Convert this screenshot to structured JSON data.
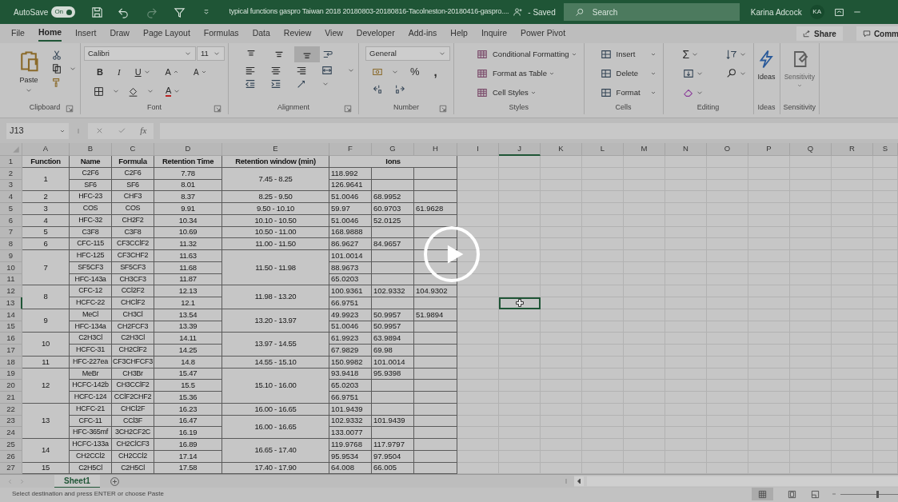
{
  "title_bar": {
    "autosave_label": "AutoSave",
    "autosave_toggle": {
      "label": "On",
      "on": true
    },
    "redo_disabled": true,
    "document_title": "typical functions gaspro Taiwan 2018 20180803-20180816-Tacolneston-20180416-gaspro....",
    "saved_status": "- Saved",
    "search_placeholder": "Search",
    "user_name": "Karina Adcock",
    "user_initials": "KA"
  },
  "menu_tabs": [
    {
      "label": "File",
      "selected": false
    },
    {
      "label": "Home",
      "selected": true
    },
    {
      "label": "Insert",
      "selected": false
    },
    {
      "label": "Draw",
      "selected": false
    },
    {
      "label": "Page Layout",
      "selected": false
    },
    {
      "label": "Formulas",
      "selected": false
    },
    {
      "label": "Data",
      "selected": false
    },
    {
      "label": "Review",
      "selected": false
    },
    {
      "label": "View",
      "selected": false
    },
    {
      "label": "Developer",
      "selected": false
    },
    {
      "label": "Add-ins",
      "selected": false
    },
    {
      "label": "Help",
      "selected": false
    },
    {
      "label": "Inquire",
      "selected": false
    },
    {
      "label": "Power Pivot",
      "selected": false
    }
  ],
  "share_button": "Share",
  "comments_button": "Comm",
  "ribbon": {
    "clipboard": {
      "paste": "Paste",
      "label": "Clipboard"
    },
    "font": {
      "font_name": "Calibri",
      "font_size": "11",
      "bold": "B",
      "italic": "I",
      "underline": "U",
      "grow": "A",
      "shrink": "A",
      "font_color": "A",
      "label": "Font"
    },
    "alignment": {
      "vertical": [
        {
          "kind": "top",
          "selected": false
        },
        {
          "kind": "middle",
          "selected": false
        },
        {
          "kind": "bottom",
          "selected": true
        }
      ],
      "label": "Alignment"
    },
    "number": {
      "format": "General",
      "percent": "%",
      "comma": ",",
      "label": "Number"
    },
    "styles": {
      "items": [
        "Conditional Formatting",
        "Format as Table",
        "Cell Styles"
      ],
      "label": "Styles"
    },
    "cells": {
      "items": [
        "Insert",
        "Delete",
        "Format"
      ],
      "label": "Cells"
    },
    "editing": {
      "sum": "Σ",
      "label": "Editing"
    },
    "ideas": {
      "button": "Ideas",
      "label": "Ideas"
    },
    "sensitivity": {
      "button": "Sensitivity",
      "disabled": true,
      "label": "Sensitivity"
    }
  },
  "formula_bar": {
    "name_box": "J13",
    "fx": "fx"
  },
  "sheet": {
    "columns": [
      {
        "label": "A",
        "selected": false
      },
      {
        "label": "B",
        "selected": false
      },
      {
        "label": "C",
        "selected": false
      },
      {
        "label": "D",
        "selected": false
      },
      {
        "label": "E",
        "selected": false
      },
      {
        "label": "F",
        "selected": false
      },
      {
        "label": "G",
        "selected": false
      },
      {
        "label": "H",
        "selected": false
      },
      {
        "label": "I",
        "selected": false
      },
      {
        "label": "J",
        "selected": true
      },
      {
        "label": "K",
        "selected": false
      },
      {
        "label": "L",
        "selected": false
      },
      {
        "label": "M",
        "selected": false
      },
      {
        "label": "N",
        "selected": false
      },
      {
        "label": "O",
        "selected": false
      },
      {
        "label": "P",
        "selected": false
      },
      {
        "label": "Q",
        "selected": false
      },
      {
        "label": "R",
        "selected": false
      },
      {
        "label": "S",
        "selected": false
      }
    ],
    "row_headers": [
      {
        "label": "1",
        "selected": false
      },
      {
        "label": "2",
        "selected": false
      },
      {
        "label": "3",
        "selected": false
      },
      {
        "label": "4",
        "selected": false
      },
      {
        "label": "5",
        "selected": false
      },
      {
        "label": "6",
        "selected": false
      },
      {
        "label": "7",
        "selected": false
      },
      {
        "label": "8",
        "selected": false
      },
      {
        "label": "9",
        "selected": false
      },
      {
        "label": "10",
        "selected": false
      },
      {
        "label": "11",
        "selected": false
      },
      {
        "label": "12",
        "selected": false
      },
      {
        "label": "13",
        "selected": true
      },
      {
        "label": "14",
        "selected": false
      },
      {
        "label": "15",
        "selected": false
      },
      {
        "label": "16",
        "selected": false
      },
      {
        "label": "17",
        "selected": false
      },
      {
        "label": "18",
        "selected": false
      },
      {
        "label": "19",
        "selected": false
      },
      {
        "label": "20",
        "selected": false
      },
      {
        "label": "21",
        "selected": false
      },
      {
        "label": "22",
        "selected": false
      },
      {
        "label": "23",
        "selected": false
      },
      {
        "label": "24",
        "selected": false
      },
      {
        "label": "25",
        "selected": false
      },
      {
        "label": "26",
        "selected": false
      },
      {
        "label": "27",
        "selected": false
      }
    ],
    "header": [
      "Function",
      "Name",
      "Formula",
      "Retention Time",
      "Retention window (min)",
      "Ions"
    ],
    "functions": [
      {
        "function": "1",
        "windows": [
          {
            "window": "7.45 - 8.25",
            "compounds": [
              {
                "name": "C2F6",
                "formula": "C2F6",
                "retention_time": "7.78",
                "ions": [
                  "118.992"
                ]
              },
              {
                "name": "SF6",
                "formula": "SF6",
                "retention_time": "8.01",
                "ions": [
                  "126.9641"
                ]
              }
            ]
          }
        ]
      },
      {
        "function": "2",
        "windows": [
          {
            "window": "8.25 - 9.50",
            "compounds": [
              {
                "name": "HFC-23",
                "formula": "CHF3",
                "retention_time": "8.37",
                "ions": [
                  "51.0046",
                  "68.9952"
                ]
              }
            ]
          }
        ]
      },
      {
        "function": "3",
        "windows": [
          {
            "window": "9.50 - 10.10",
            "compounds": [
              {
                "name": "COS",
                "formula": "COS",
                "retention_time": "9.91",
                "ions": [
                  "59.97",
                  "60.9703",
                  "61.9628"
                ]
              }
            ]
          }
        ]
      },
      {
        "function": "4",
        "windows": [
          {
            "window": "10.10 - 10.50",
            "compounds": [
              {
                "name": "HFC-32",
                "formula": "CH2F2",
                "retention_time": "10.34",
                "ions": [
                  "51.0046",
                  "52.0125"
                ]
              }
            ]
          }
        ]
      },
      {
        "function": "5",
        "windows": [
          {
            "window": "10.50 - 11.00",
            "compounds": [
              {
                "name": "C3F8",
                "formula": "C3F8",
                "retention_time": "10.69",
                "ions": [
                  "168.9888"
                ]
              }
            ]
          }
        ]
      },
      {
        "function": "6",
        "windows": [
          {
            "window": "11.00 - 11.50",
            "compounds": [
              {
                "name": "CFC-115",
                "formula": "CF3CClF2",
                "retention_time": "11.32",
                "ions": [
                  "86.9627",
                  "84.9657"
                ]
              }
            ]
          }
        ]
      },
      {
        "function": "7",
        "windows": [
          {
            "window": "11.50 - 11.98",
            "compounds": [
              {
                "name": "HFC-125",
                "formula": "CF3CHF2",
                "retention_time": "11.63",
                "ions": [
                  "101.0014"
                ]
              },
              {
                "name": "SF5CF3",
                "formula": "SF5CF3",
                "retention_time": "11.68",
                "ions": [
                  "88.9673"
                ]
              },
              {
                "name": "HFC-143a",
                "formula": "CH3CF3",
                "retention_time": "11.87",
                "ions": [
                  "65.0203"
                ]
              }
            ]
          }
        ]
      },
      {
        "function": "8",
        "windows": [
          {
            "window": "11.98 - 13.20",
            "compounds": [
              {
                "name": "CFC-12",
                "formula": "CCl2F2",
                "retention_time": "12.13",
                "ions": [
                  "100.9361",
                  "102.9332",
                  "104.9302"
                ]
              },
              {
                "name": "HCFC-22",
                "formula": "CHClF2",
                "retention_time": "12.1",
                "ions": [
                  "66.9751"
                ]
              }
            ]
          }
        ]
      },
      {
        "function": "9",
        "windows": [
          {
            "window": "13.20 - 13.97",
            "compounds": [
              {
                "name": "MeCl",
                "formula": "CH3Cl",
                "retention_time": "13.54",
                "ions": [
                  "49.9923",
                  "50.9957",
                  "51.9894"
                ]
              },
              {
                "name": "HFC-134a",
                "formula": "CH2FCF3",
                "retention_time": "13.39",
                "ions": [
                  "51.0046",
                  "50.9957"
                ]
              }
            ]
          }
        ]
      },
      {
        "function": "10",
        "windows": [
          {
            "window": "13.97 - 14.55",
            "compounds": [
              {
                "name": "C2H3Cl",
                "formula": "C2H3Cl",
                "retention_time": "14.11",
                "ions": [
                  "61.9923",
                  "63.9894"
                ]
              },
              {
                "name": "HCFC-31",
                "formula": "CH2ClF2",
                "retention_time": "14.25",
                "ions": [
                  "67.9829",
                  "69.98"
                ]
              }
            ]
          }
        ]
      },
      {
        "function": "11",
        "windows": [
          {
            "window": "14.55 - 15.10",
            "compounds": [
              {
                "name": "HFC-227ea",
                "formula": "CF3CHFCF3",
                "retention_time": "14.8",
                "ions": [
                  "150.9982",
                  "101.0014"
                ]
              }
            ]
          }
        ]
      },
      {
        "function": "12",
        "windows": [
          {
            "window": "15.10 - 16.00",
            "compounds": [
              {
                "name": "MeBr",
                "formula": "CH3Br",
                "retention_time": "15.47",
                "ions": [
                  "93.9418",
                  "95.9398"
                ]
              },
              {
                "name": "HCFC-142b",
                "formula": "CH3CClF2",
                "retention_time": "15.5",
                "ions": [
                  "65.0203"
                ]
              },
              {
                "name": "HCFC-124",
                "formula": "CClF2CHF2",
                "retention_time": "15.36",
                "ions": [
                  "66.9751"
                ]
              }
            ]
          }
        ]
      },
      {
        "function": "13",
        "windows": [
          {
            "window": "16.00 - 16.65",
            "compounds": [
              {
                "name": "HCFC-21",
                "formula": "CHCl2F",
                "retention_time": "16.23",
                "ions": [
                  "101.9439"
                ]
              }
            ]
          },
          {
            "window": "16.00 - 16.65",
            "compounds": [
              {
                "name": "CFC-11",
                "formula": "CCl3F",
                "retention_time": "16.47",
                "ions": [
                  "102.9332",
                  "101.9439"
                ]
              },
              {
                "name": "HFC-365mf",
                "formula": "3CH2CF2C",
                "retention_time": "16.19",
                "ions": [
                  "133.0077"
                ]
              }
            ]
          }
        ]
      },
      {
        "function": "14",
        "windows": [
          {
            "window": "16.65 - 17.40",
            "compounds": [
              {
                "name": "HCFC-133a",
                "formula": "CH2ClCF3",
                "retention_time": "16.89",
                "ions": [
                  "119.9768",
                  "117.9797"
                ]
              },
              {
                "name": "CH2CCl2",
                "formula": "CH2CCl2",
                "retention_time": "17.14",
                "ions": [
                  "95.9534",
                  "97.9504"
                ]
              }
            ]
          }
        ]
      },
      {
        "function": "15",
        "windows": [
          {
            "window": "17.40 - 17.90",
            "compounds": [
              {
                "name": "C2H5Cl",
                "formula": "C2H5Cl",
                "retention_time": "17.58",
                "ions": [
                  "64.008",
                  "66.005"
                ]
              }
            ]
          }
        ]
      }
    ]
  },
  "sheet_tabs": [
    {
      "label": "Sheet1",
      "selected": true
    }
  ],
  "status_bar": {
    "message": "Select destination and press ENTER or choose Paste",
    "zoom_slider": {
      "level": 0.63
    }
  }
}
